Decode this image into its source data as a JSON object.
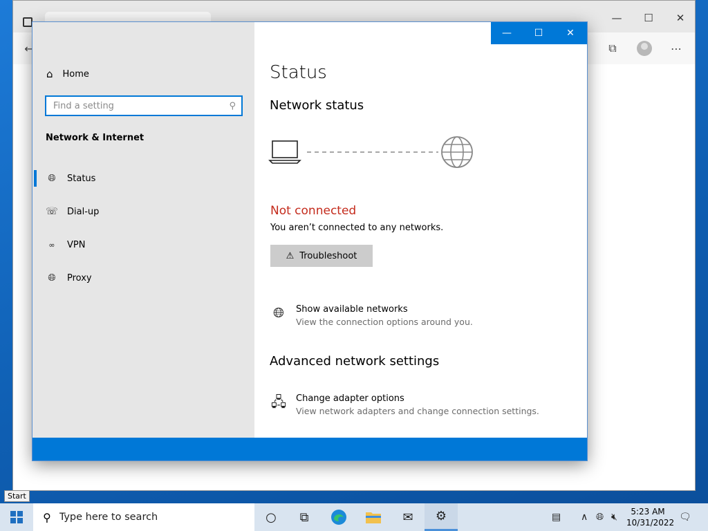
{
  "settings": {
    "sidebar": {
      "home_label": "Home",
      "search_placeholder": "Find a setting",
      "section_title": "Network & Internet",
      "items": [
        {
          "label": "Status",
          "icon": "status-globe-icon",
          "active": true
        },
        {
          "label": "Dial-up",
          "icon": "dialup-icon",
          "active": false
        },
        {
          "label": "VPN",
          "icon": "vpn-icon",
          "active": false
        },
        {
          "label": "Proxy",
          "icon": "globe-icon",
          "active": false
        }
      ]
    },
    "content": {
      "title": "Status",
      "network_status_heading": "Network status",
      "connection_state": "Not connected",
      "connection_description": "You aren’t connected to any networks.",
      "troubleshoot_label": "Troubleshoot",
      "show_networks": {
        "title": "Show available networks",
        "description": "View the connection options around you."
      },
      "advanced_heading": "Advanced network settings",
      "adapter_options": {
        "title": "Change adapter options",
        "description": "View network adapters and change connection settings."
      }
    },
    "window_controls": {
      "minimize": "—",
      "maximize": "☐",
      "close": "✕"
    }
  },
  "taskbar": {
    "search_placeholder": "Type here to search",
    "start_tooltip": "Start",
    "clock_time": "5:23 AM",
    "clock_date": "10/31/2022"
  },
  "colors": {
    "accent": "#0078d7",
    "error": "#c42b1c",
    "sidebar_bg": "#e6e6e6",
    "button_bg": "#cccccc"
  }
}
